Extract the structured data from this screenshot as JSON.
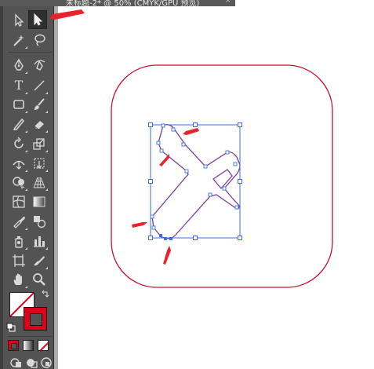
{
  "window": {
    "title_fragment": "未标题-2* @ 50% (CMYK/GPU 预览)",
    "close_glyph": "×"
  },
  "toolbar": {
    "tools": [
      {
        "id": "selection",
        "icon": "selection-arrow-icon"
      },
      {
        "id": "direct-selection",
        "icon": "direct-selection-arrow-icon",
        "active": true
      },
      {
        "id": "magic-wand",
        "icon": "magic-wand-icon"
      },
      {
        "id": "lasso",
        "icon": "lasso-icon"
      },
      {
        "id": "pen",
        "icon": "pen-icon"
      },
      {
        "id": "curvature",
        "icon": "curvature-pen-icon"
      },
      {
        "id": "type",
        "icon": "type-icon",
        "glyph": "T"
      },
      {
        "id": "line",
        "icon": "line-segment-icon"
      },
      {
        "id": "rectangle",
        "icon": "rectangle-icon"
      },
      {
        "id": "paintbrush",
        "icon": "paintbrush-icon"
      },
      {
        "id": "pencil",
        "icon": "pencil-icon"
      },
      {
        "id": "eraser",
        "icon": "eraser-icon"
      },
      {
        "id": "rotate",
        "icon": "rotate-icon"
      },
      {
        "id": "scale",
        "icon": "scale-icon"
      },
      {
        "id": "width",
        "icon": "width-tool-icon"
      },
      {
        "id": "free-transform",
        "icon": "free-transform-icon"
      },
      {
        "id": "shape-builder",
        "icon": "shape-builder-icon"
      },
      {
        "id": "perspective-grid",
        "icon": "perspective-grid-icon"
      },
      {
        "id": "mesh",
        "icon": "mesh-icon"
      },
      {
        "id": "gradient",
        "icon": "gradient-icon"
      },
      {
        "id": "eyedropper",
        "icon": "eyedropper-icon"
      },
      {
        "id": "blend",
        "icon": "blend-icon"
      },
      {
        "id": "symbol-sprayer",
        "icon": "symbol-sprayer-icon"
      },
      {
        "id": "column-graph",
        "icon": "column-graph-icon"
      },
      {
        "id": "artboard",
        "icon": "artboard-icon"
      },
      {
        "id": "slice",
        "icon": "slice-icon"
      },
      {
        "id": "hand",
        "icon": "hand-icon"
      },
      {
        "id": "zoom",
        "icon": "zoom-icon"
      }
    ],
    "fill_color": "#ffffff",
    "stroke_color": "#e0001a",
    "panel_color": "#535353"
  },
  "canvas": {
    "background": "#ffffff",
    "rounded_square_stroke": "#c8102e",
    "selection_color": "#3a6fe0",
    "annotation_arrow_color": "#e8232b"
  }
}
